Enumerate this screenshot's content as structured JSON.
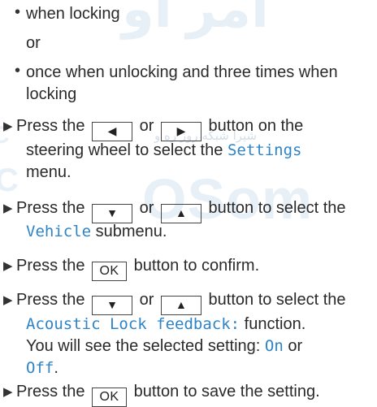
{
  "watermark": {
    "top_text": "امر او",
    "mid_text": "OSom",
    "fa_text": "شیرا شبکه روز ره و",
    "side_c": "C",
    "side_c2": "C"
  },
  "bullets": {
    "b1": "when locking",
    "or_text": "or",
    "b2_line1": "once when unlocking and three times when",
    "b2_line2": "locking"
  },
  "steps": {
    "s1": {
      "press": "Press the",
      "btn_left": "◀",
      "or": "or",
      "btn_right": "▶",
      "rest": "button on the",
      "line2a": "steering wheel to select the",
      "line2_menu": "Settings",
      "line3": "menu."
    },
    "s2": {
      "press": "Press the",
      "btn_down": "▼",
      "or": "or",
      "btn_up": "▲",
      "rest": "button to select the",
      "menu": "Vehicle",
      "line2b": "submenu."
    },
    "s3": {
      "press": "Press the",
      "btn_ok": "OK",
      "rest": "button to confirm."
    },
    "s4": {
      "press": "Press the",
      "btn_down": "▼",
      "or": "or",
      "btn_up": "▲",
      "rest": "button to select the",
      "func": "Acoustic Lock feedback:",
      "func_rest": "function.",
      "line3": "You will see the selected setting:",
      "on": "On",
      "or2": "or",
      "off": "Off",
      "period": "."
    },
    "s5": {
      "press": "Press the",
      "btn_ok": "OK",
      "rest": "button to save the setting."
    }
  },
  "glyphs": {
    "bullet": "•",
    "step_arrow": "▶"
  },
  "colors": {
    "accent": "#2d84c8",
    "text": "#2a2a2a",
    "watermark": "#e7eff7"
  }
}
